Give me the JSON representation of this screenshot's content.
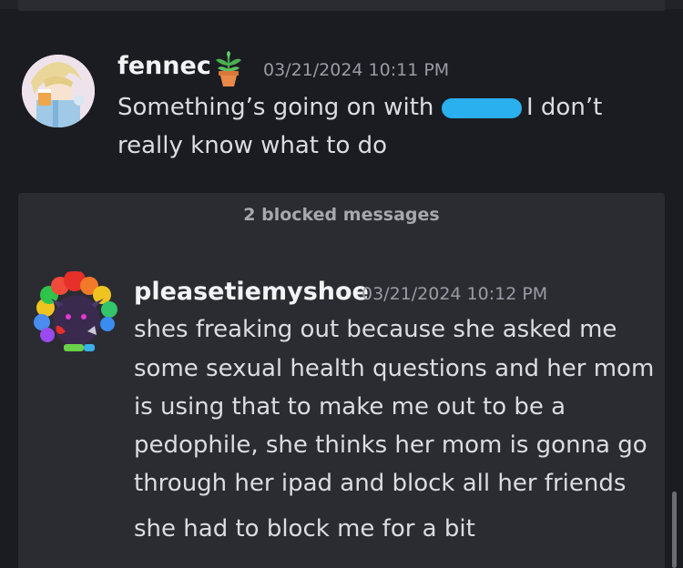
{
  "messages": [
    {
      "author": "fennec",
      "author_badge_icon": "potted-plant-icon",
      "timestamp": "03/21/2024 10:11 PM",
      "lines": [
        "Something’s going on with",
        "I don’t",
        "really know what to do"
      ]
    }
  ],
  "blocked": {
    "label": "2 blocked messages",
    "message": {
      "author": "pleasetiemyshoe",
      "timestamp": "03/21/2024 10:12 PM",
      "lines": [
        "shes freaking out because she asked me",
        "some sexual health questions and her mom",
        "is using that to make me out to be a",
        "pedophile, she thinks her mom is gonna go",
        "through her ipad and block all her friends"
      ],
      "followup": "she had to block me for a bit"
    }
  },
  "colors": {
    "background": "#1b1c21",
    "card": "#2b2c32",
    "redaction": "#2ab0ee"
  }
}
